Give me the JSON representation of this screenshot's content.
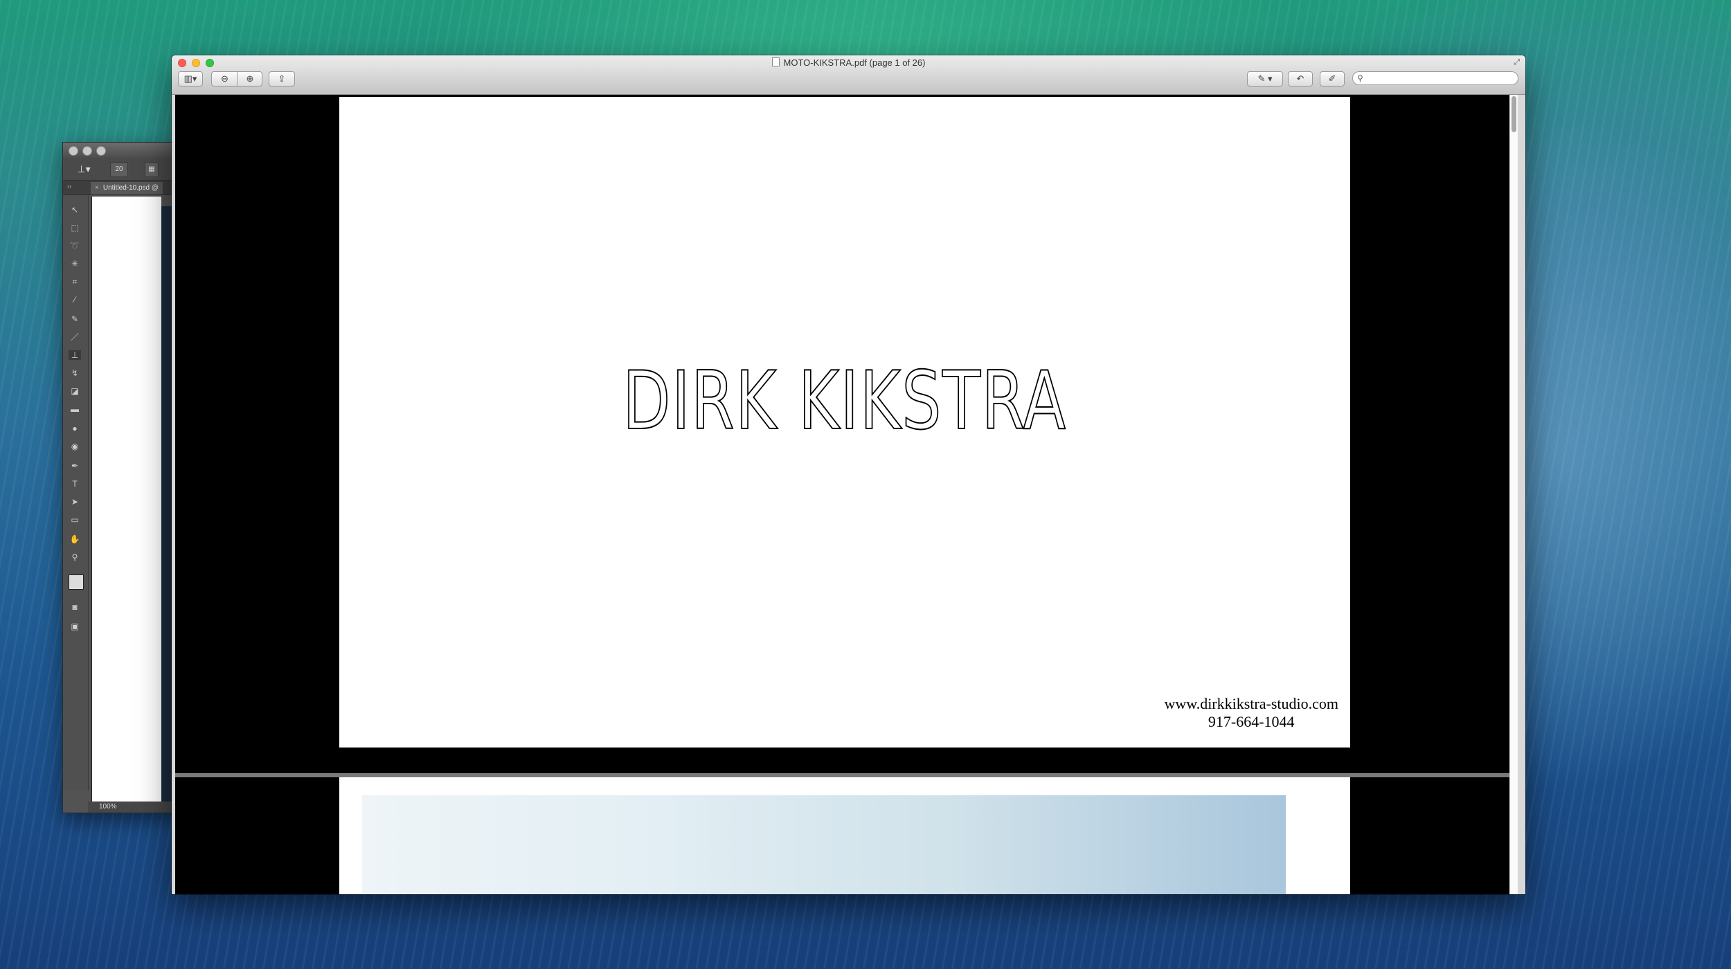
{
  "photoshop": {
    "brush_size": "20",
    "tab_label": "Untitled-10.psd @",
    "zoom": "100%"
  },
  "preview": {
    "title": "MOTO-KIKSTRA.pdf (page 1 of 26)",
    "search_placeholder": "",
    "toolbar_icons": [
      "sidebar-icon",
      "zoom-out-icon",
      "zoom-in-icon",
      "share-icon",
      "annotate-icon",
      "rotate-icon",
      "edit-icon",
      "search-icon"
    ]
  },
  "document": {
    "heading": "DIRK KIKSTRA",
    "website": "www.dirkkikstra-studio.com",
    "phone": "917-664-1044"
  },
  "colors": {
    "close": "#fc5f57",
    "minimize": "#fdbc2e",
    "zoom": "#33c748"
  }
}
